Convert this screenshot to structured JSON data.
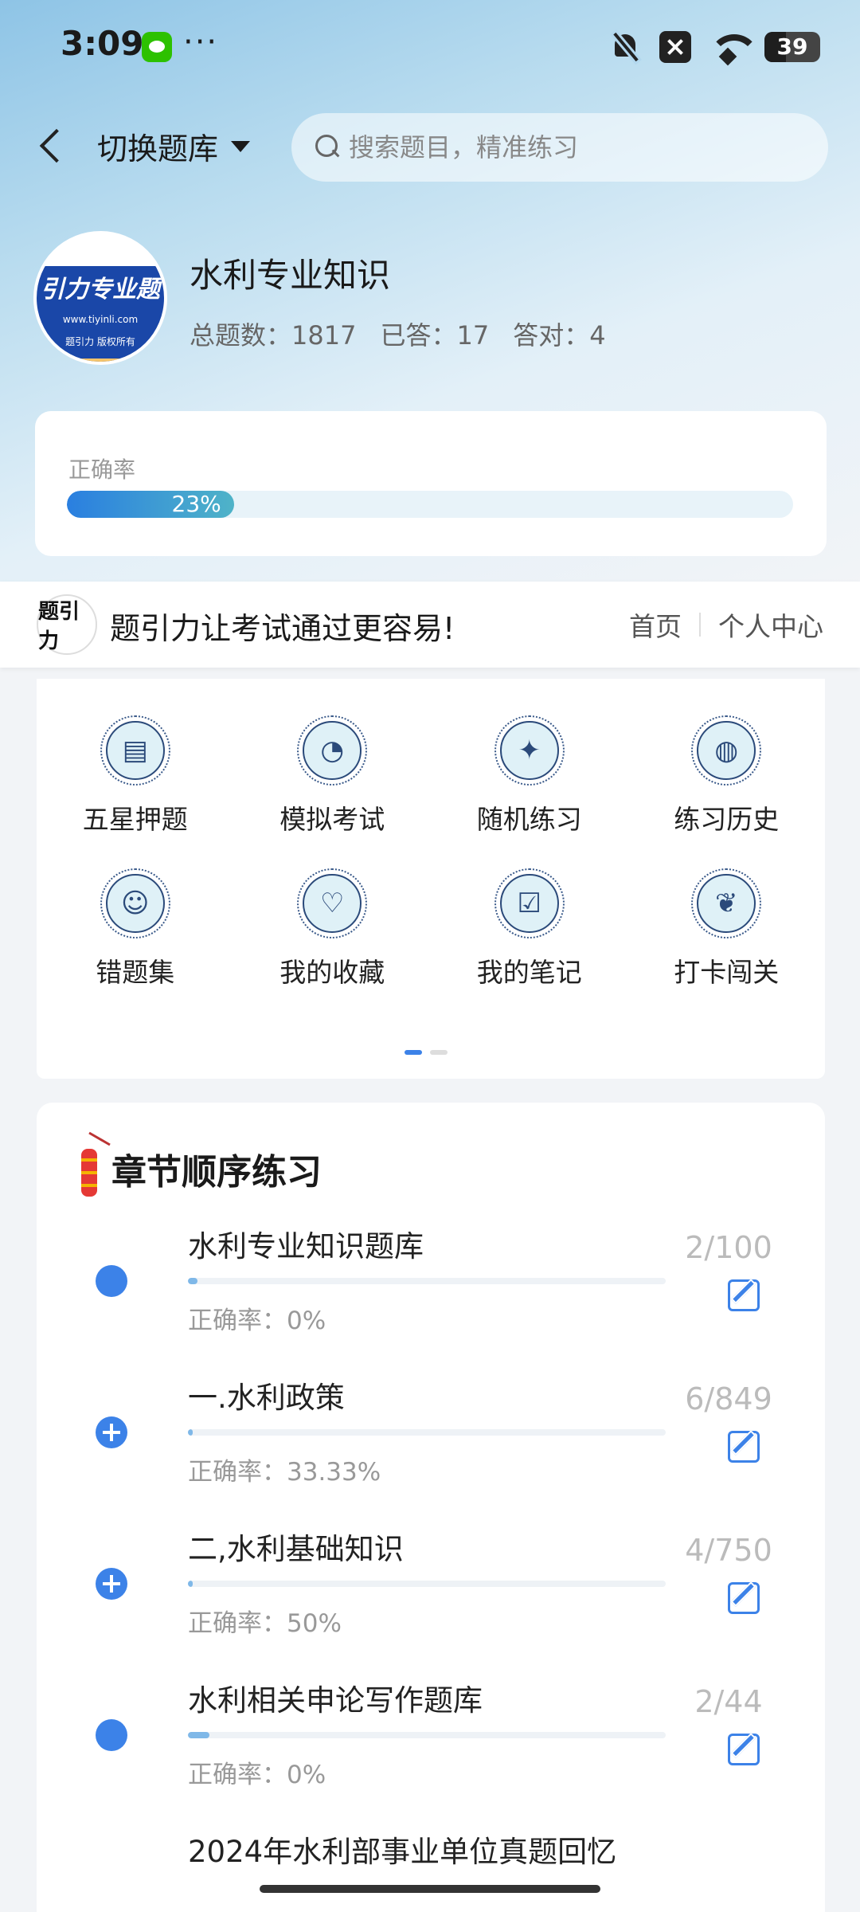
{
  "status_bar": {
    "time": "3:09",
    "more": "···",
    "battery": "39",
    "battery_level": 0.39
  },
  "nav": {
    "switch_label": "切换题库",
    "search_placeholder": "搜索题目，精准练习"
  },
  "bank": {
    "logo_text": "引力专业题",
    "logo_url": "www.tiyinli.com",
    "logo_footer": "题引力 版权所有",
    "title": "水利专业知识",
    "total": "总题数：1817",
    "answered": "已答：17",
    "correct": "答对：4"
  },
  "accuracy": {
    "label": "正确率",
    "value": "23%",
    "fraction": 0.23
  },
  "banner": {
    "logo": "题引力",
    "slogan": "题引力让考试通过更容易!",
    "link_home": "首页",
    "link_profile": "个人中心"
  },
  "menu": {
    "items": [
      {
        "label": "五星押题",
        "icon": "id-card-icon"
      },
      {
        "label": "模拟考试",
        "icon": "speedometer-icon"
      },
      {
        "label": "随机练习",
        "icon": "network-icon"
      },
      {
        "label": "练习历史",
        "icon": "globe-icon"
      },
      {
        "label": "错题集",
        "icon": "head-icon"
      },
      {
        "label": "我的收藏",
        "icon": "heart-icon"
      },
      {
        "label": "我的笔记",
        "icon": "note-check-icon"
      },
      {
        "label": "打卡闯关",
        "icon": "sprout-icon"
      }
    ],
    "page": 1,
    "pages": 2
  },
  "chapters": {
    "title": "章节顺序练习",
    "items": [
      {
        "name": "水利专业知识题库",
        "accuracy": "正确率：0%",
        "count": "2/100",
        "progress": 0.02,
        "expandable": false
      },
      {
        "name": "一.水利政策",
        "accuracy": "正确率：33.33%",
        "count": "6/849",
        "progress": 0.007,
        "expandable": true
      },
      {
        "name": "二,水利基础知识",
        "accuracy": "正确率：50%",
        "count": "4/750",
        "progress": 0.005,
        "expandable": true
      },
      {
        "name": "水利相关申论写作题库",
        "accuracy": "正确率：0%",
        "count": "2/44",
        "progress": 0.045,
        "expandable": false
      },
      {
        "name": "2024年水利部事业单位真题回忆",
        "accuracy": "",
        "count": "",
        "progress": 0,
        "expandable": false
      }
    ]
  }
}
